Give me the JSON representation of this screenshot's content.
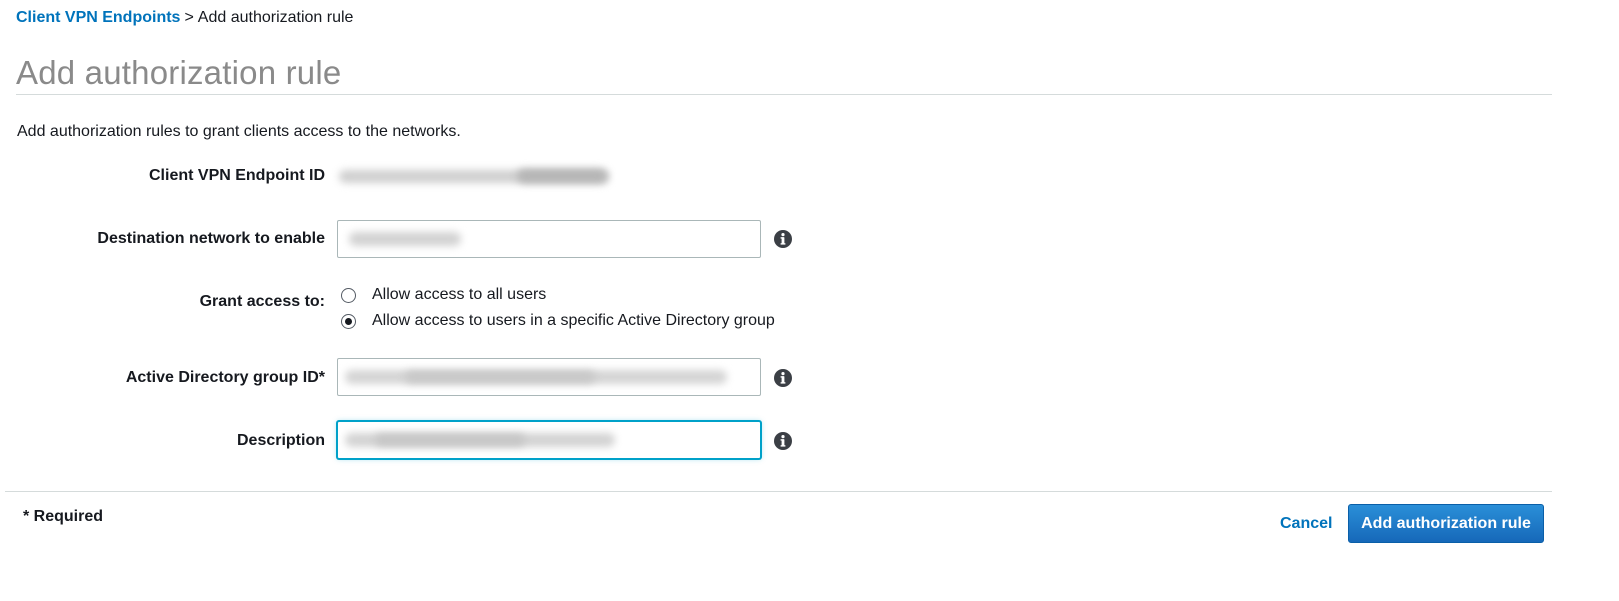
{
  "breadcrumb": {
    "parent": "Client VPN Endpoints",
    "separator": ">",
    "current": "Add authorization rule"
  },
  "page": {
    "title": "Add authorization rule",
    "intro": "Add authorization rules to grant clients access to the networks."
  },
  "form": {
    "endpoint_id": {
      "label": "Client VPN Endpoint ID",
      "value_redacted": true
    },
    "destination_network": {
      "label": "Destination network to enable",
      "value_redacted": true,
      "info_icon": "info-circle-icon"
    },
    "grant_access": {
      "label": "Grant access to:",
      "options": [
        {
          "label": "Allow access to all users",
          "selected": false
        },
        {
          "label": "Allow access to users in a specific Active Directory group",
          "selected": true
        }
      ]
    },
    "ad_group_id": {
      "label": "Active Directory group ID*",
      "value_redacted": true,
      "info_icon": "info-circle-icon"
    },
    "description": {
      "label": "Description",
      "value_redacted": true,
      "focused": true,
      "info_icon": "info-circle-icon"
    }
  },
  "footer": {
    "required_note": "* Required",
    "cancel_label": "Cancel",
    "submit_label": "Add authorization rule"
  },
  "colors": {
    "link": "#0073bb",
    "primary_button": "#1a73c4",
    "title_gray": "#8a8a8a",
    "focus_ring": "#00a1c9"
  }
}
